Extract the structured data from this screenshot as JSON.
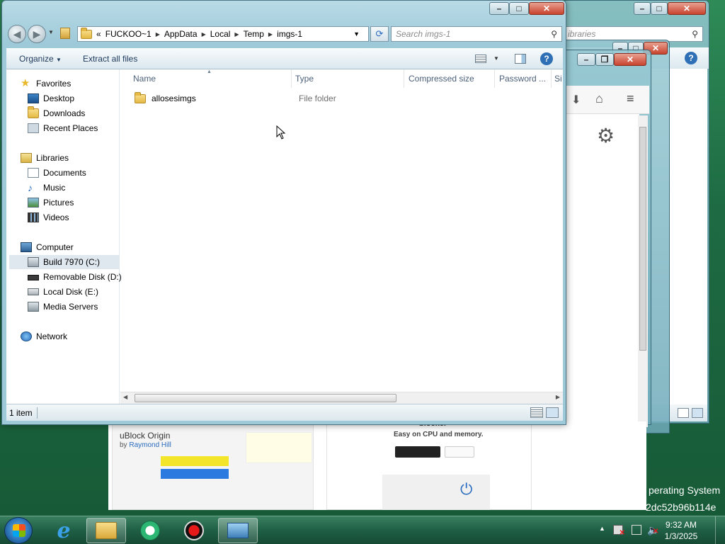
{
  "explorer": {
    "address": {
      "overflow": "«",
      "crumbs": [
        "FUCKOO~1",
        "AppData",
        "Local",
        "Temp",
        "imgs-1"
      ]
    },
    "search_placeholder": "Search imgs-1",
    "toolbar": {
      "organize": "Organize",
      "extract": "Extract all files"
    },
    "nav": {
      "favorites": "Favorites",
      "desktop": "Desktop",
      "downloads": "Downloads",
      "recent": "Recent Places",
      "libraries": "Libraries",
      "documents": "Documents",
      "music": "Music",
      "pictures": "Pictures",
      "videos": "Videos",
      "computer": "Computer",
      "drive_c": "Build 7970 (C:)",
      "drive_d": "Removable Disk (D:)",
      "drive_e": "Local Disk (E:)",
      "media": "Media Servers",
      "network": "Network"
    },
    "columns": {
      "name": "Name",
      "type": "Type",
      "compressed": "Compressed size",
      "password": "Password ...",
      "size": "Si"
    },
    "files": [
      {
        "name": "allosesimgs",
        "type": "File folder"
      }
    ],
    "status": "1 item"
  },
  "background": {
    "libraries_search": "ibraries",
    "browser": {
      "ublock_title": "uBlock Origin",
      "ublock_by": "by",
      "ublock_author": "Raymond Hill",
      "blocker_title": "blocker",
      "blocker_tagline": "Easy on CPU and memory."
    },
    "desktop_text": {
      "os_line": "perating System",
      "hash_line": "2dc52b96b114e"
    }
  },
  "taskbar": {
    "time": "9:32 AM",
    "date": "1/3/2025"
  }
}
